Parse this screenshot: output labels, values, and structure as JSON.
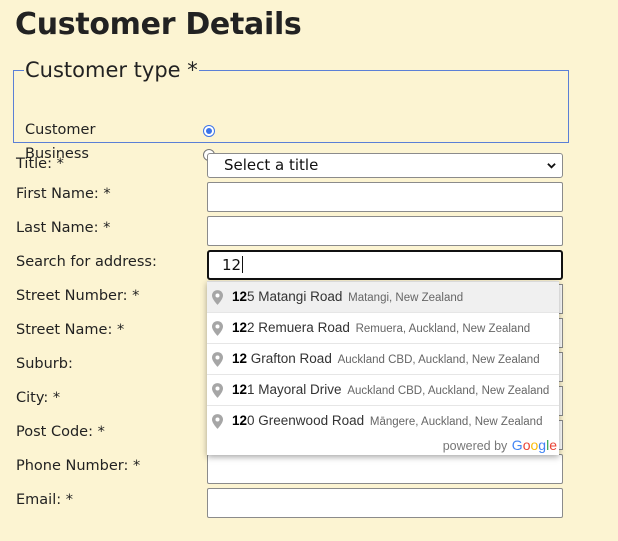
{
  "page": {
    "title": "Customer Details"
  },
  "customer_type": {
    "legend": "Customer type *",
    "options": [
      {
        "label": "Customer",
        "checked": true
      },
      {
        "label": "Business",
        "checked": false
      }
    ]
  },
  "form": {
    "title_label": "Title: *",
    "title_value": "Select a title",
    "first_name_label": "First Name: *",
    "first_name_value": "",
    "last_name_label": "Last Name: *",
    "last_name_value": "",
    "search_label": "Search for address:",
    "search_value": "12",
    "street_number_label": "Street Number: *",
    "street_name_label": "Street Name: *",
    "suburb_label": "Suburb:",
    "city_label": "City: *",
    "post_code_label": "Post Code: *",
    "phone_label": "Phone Number: *",
    "phone_value": "",
    "email_label": "Email: *",
    "email_value": ""
  },
  "autocomplete": {
    "suggestions": [
      {
        "match": "12",
        "rest": "5 Matangi Road",
        "secondary": "Matangi, New Zealand"
      },
      {
        "match": "12",
        "rest": "2 Remuera Road",
        "secondary": "Remuera, Auckland, New Zealand"
      },
      {
        "match": "12",
        "rest": " Grafton Road",
        "secondary": "Auckland CBD, Auckland, New Zealand"
      },
      {
        "match": "12",
        "rest": "1 Mayoral Drive",
        "secondary": "Auckland CBD, Auckland, New Zealand"
      },
      {
        "match": "12",
        "rest": "0 Greenwood Road",
        "secondary": "Māngere, Auckland, New Zealand"
      }
    ],
    "powered_by": "powered by",
    "logo_letters": [
      "G",
      "o",
      "o",
      "g",
      "l",
      "e"
    ]
  },
  "icons": {
    "pin": "map-pin-icon",
    "chevron": "chevron-down-icon"
  },
  "colors": {
    "background": "#fcf4d2",
    "fieldset_border": "#5b7fd6",
    "radio_accent": "#3b73e8"
  }
}
